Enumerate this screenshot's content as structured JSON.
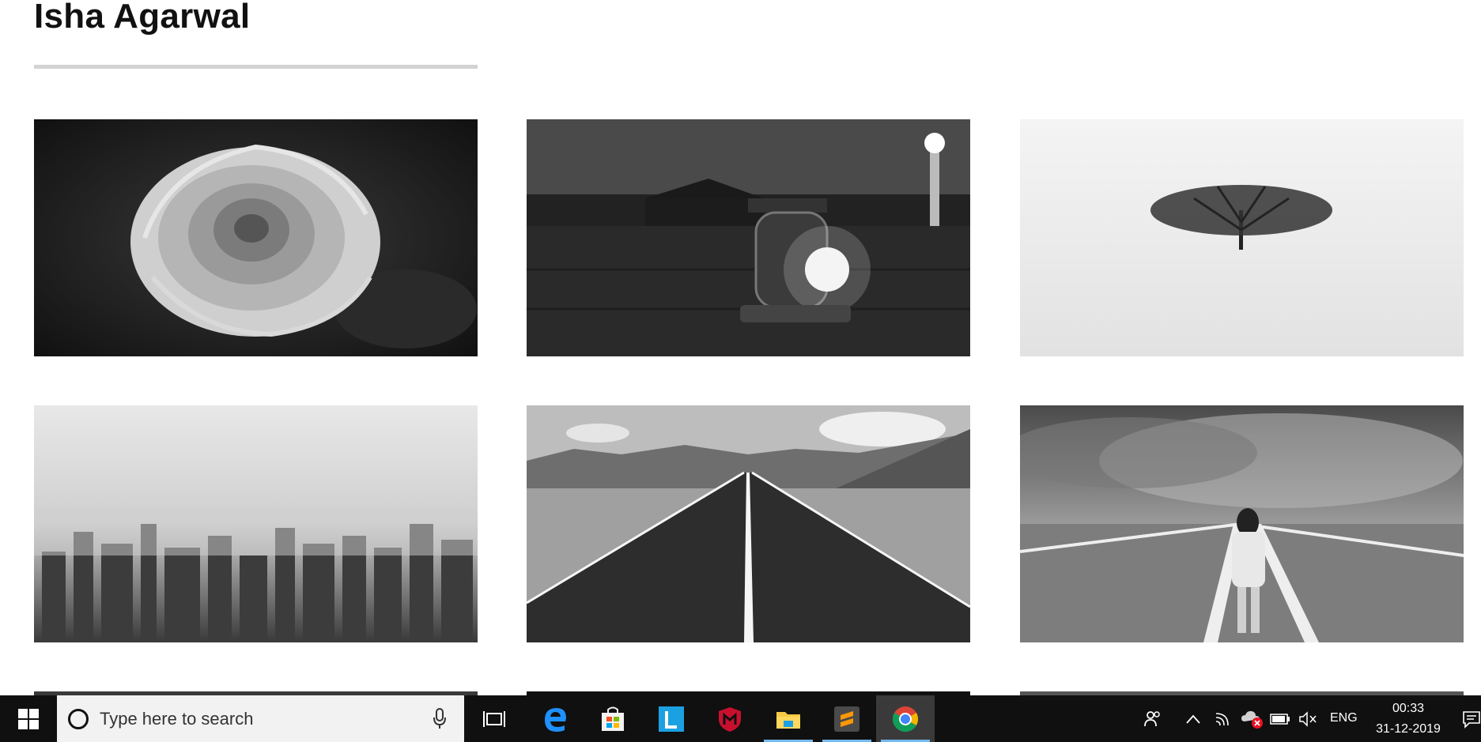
{
  "page": {
    "title": "Isha Agarwal"
  },
  "gallery": [
    {
      "subject": "rose"
    },
    {
      "subject": "lantern"
    },
    {
      "subject": "lone-tree"
    },
    {
      "subject": "misty-city"
    },
    {
      "subject": "desert-road"
    },
    {
      "subject": "woman-on-road"
    }
  ],
  "taskbar": {
    "search_placeholder": "Type here to search",
    "apps": [
      "edge",
      "store",
      "l-app",
      "mcafee",
      "file-explorer",
      "sublime-text",
      "chrome"
    ],
    "active_app": "chrome",
    "tray": {
      "language": "ENG",
      "time": "00:33",
      "date": "31-12-2019"
    }
  },
  "colors": {
    "taskbar_bg": "#101010",
    "running_indicator": "#76b9ed",
    "title_rule": "#d3d3d3"
  }
}
